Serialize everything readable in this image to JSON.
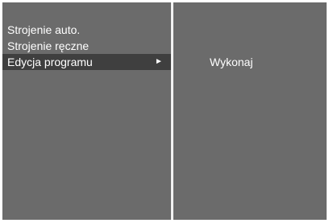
{
  "menu": {
    "items": [
      {
        "label": "Strojenie auto."
      },
      {
        "label": "Strojenie ręczne"
      },
      {
        "label": "Edycja programu",
        "selected": true,
        "submenu_arrow": "►"
      }
    ]
  },
  "submenu": {
    "action_label": "Wykonaj"
  },
  "colors": {
    "panel": "#6b6b6b",
    "selected_row": "#3f3f3f",
    "divider": "#f2f2f2",
    "text": "#ffffff"
  },
  "icons": {
    "submenu_arrow": "right-triangle-arrow-icon"
  }
}
